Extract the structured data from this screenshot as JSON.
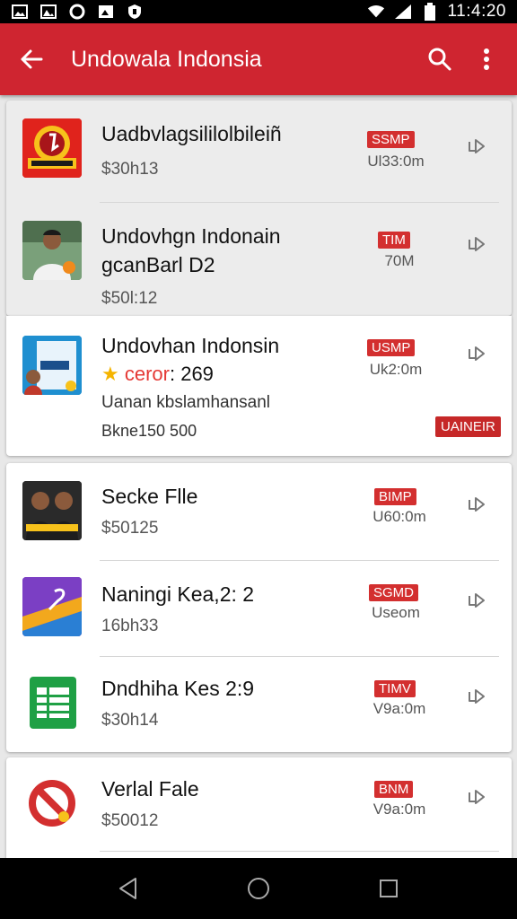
{
  "status_bar": {
    "time": "11:4:20",
    "left_icons": [
      "image-icon",
      "image-icon",
      "circle-icon",
      "photo-icon",
      "shield-icon"
    ],
    "right_icons": [
      "wifi-icon",
      "signal-icon",
      "battery-icon"
    ]
  },
  "app_bar": {
    "title": "Undowala Indonsia",
    "back_icon": "arrow-left-icon",
    "search_icon": "search-icon",
    "more_icon": "more-vert-icon"
  },
  "colors": {
    "accent": "#cf2530",
    "badge": "#d32f2f"
  },
  "items": [
    {
      "title": "Uadbvlagsililolbileiñ",
      "subtitle": "$30h13",
      "badge": "SSMP",
      "size": "Ul33:0m"
    },
    {
      "title": "Undovhgn Indonain",
      "line2": "gcanBarl D2",
      "subtitle": "$50l:12",
      "badge": "TIM",
      "size": "70M"
    },
    {
      "title": "Undovhan Indonsin",
      "rating_prefix": "★",
      "rating_text": "ceror",
      "rating_value": ": 269",
      "desc": "Uanan kbslamhansanl",
      "meta": "Bkne150 500",
      "badge": "USMP",
      "size": "Uk2:0m",
      "action": "UAINEIR"
    },
    {
      "title": "Secke Flle",
      "subtitle": "$50125",
      "badge": "BIMP",
      "size": "U60:0m"
    },
    {
      "title": "Naningi Kea,2: 2",
      "subtitle": "16bh33",
      "badge": "SGMD",
      "size": "Useom"
    },
    {
      "title": "Dndhiha Kes 2:9",
      "subtitle": "$30h14",
      "badge": "TIMV",
      "size": "V9a:0m"
    },
    {
      "title": "Verlal Fale",
      "subtitle": "$50012",
      "badge": "BNM",
      "size": "V9a:0m"
    }
  ],
  "nav": {
    "back": "nav-back-icon",
    "home": "nav-home-icon",
    "recents": "nav-recents-icon"
  }
}
